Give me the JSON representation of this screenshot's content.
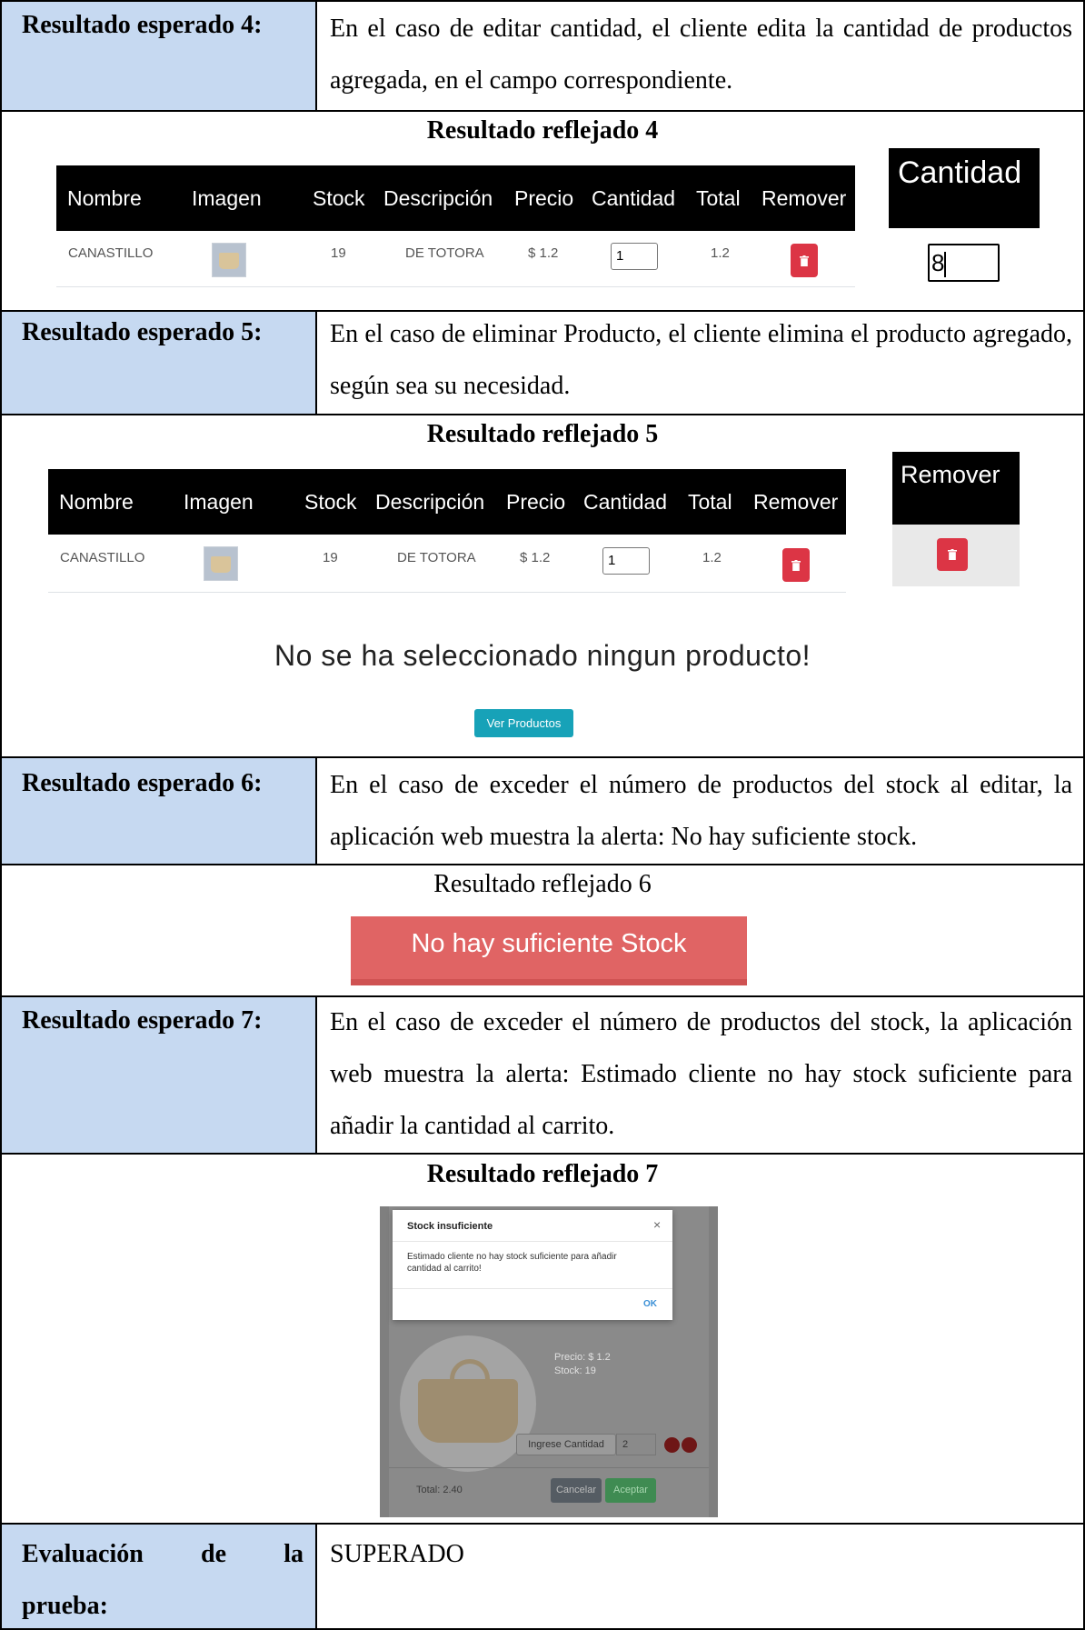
{
  "rows": {
    "r4": {
      "label": "Resultado esperado 4:",
      "text": "En el caso de editar cantidad, el cliente edita la cantidad de productos agregada, en el campo correspondiente."
    },
    "f4": {
      "title": "Resultado reflejado 4",
      "headers": [
        "Nombre",
        "Imagen",
        "Stock",
        "Descripción",
        "Precio",
        "Cantidad",
        "Total",
        "Remover"
      ],
      "row": {
        "nombre": "CANASTILLO",
        "stock": "19",
        "descripcion": "DE TOTORA",
        "precio": "$ 1.2",
        "cantidad": "1",
        "total": "1.2"
      },
      "zoom_header": "Cantidad",
      "zoom_value": "8"
    },
    "r5": {
      "label": "Resultado esperado 5:",
      "text": "En el caso de eliminar Producto, el cliente elimina el producto agregado, según sea su necesidad."
    },
    "f5": {
      "title": "Resultado reflejado 5",
      "headers": [
        "Nombre",
        "Imagen",
        "Stock",
        "Descripción",
        "Precio",
        "Cantidad",
        "Total",
        "Remover"
      ],
      "row": {
        "nombre": "CANASTILLO",
        "stock": "19",
        "descripcion": "DE TOTORA",
        "precio": "$ 1.2",
        "cantidad": "1",
        "total": "1.2"
      },
      "zoom_header": "Remover",
      "empty_message": "No se ha seleccionado ningun producto!",
      "button": "Ver Productos"
    },
    "r6": {
      "label": "Resultado esperado 6:",
      "text": "En el caso de exceder el número de productos del stock al editar, la aplicación web muestra la alerta: No hay suficiente stock."
    },
    "f6": {
      "title": "Resultado reflejado 6",
      "alert": "No hay suficiente Stock"
    },
    "r7": {
      "label": "Resultado esperado 7:",
      "text": "En el caso de exceder el número de productos del stock, la aplicación web muestra la alerta: Estimado cliente no hay stock suficiente para añadir la cantidad al carrito."
    },
    "f7": {
      "title": "Resultado reflejado 7",
      "dialog_title": "Stock insuficiente",
      "dialog_close": "×",
      "dialog_body": "Estimado cliente no hay stock suficiente para añadir cantidad al carrito!",
      "dialog_ok": "OK",
      "precio": "Precio: $ 1.2",
      "stock": "Stock: 19",
      "ingrese_label": "Ingrese Cantidad",
      "ingrese_value": "2",
      "total": "Total: 2.40",
      "cancelar": "Cancelar",
      "aceptar": "Aceptar"
    },
    "eval": {
      "label_a": "Evaluación",
      "label_b": "de",
      "label_c": "la",
      "label_d": "prueba:",
      "result": "SUPERADO"
    }
  },
  "colors": {
    "label_shade": "#c6d9f1",
    "delete_red": "#dc3545",
    "alert_red": "#e06464",
    "info_button": "#17a2b8"
  }
}
